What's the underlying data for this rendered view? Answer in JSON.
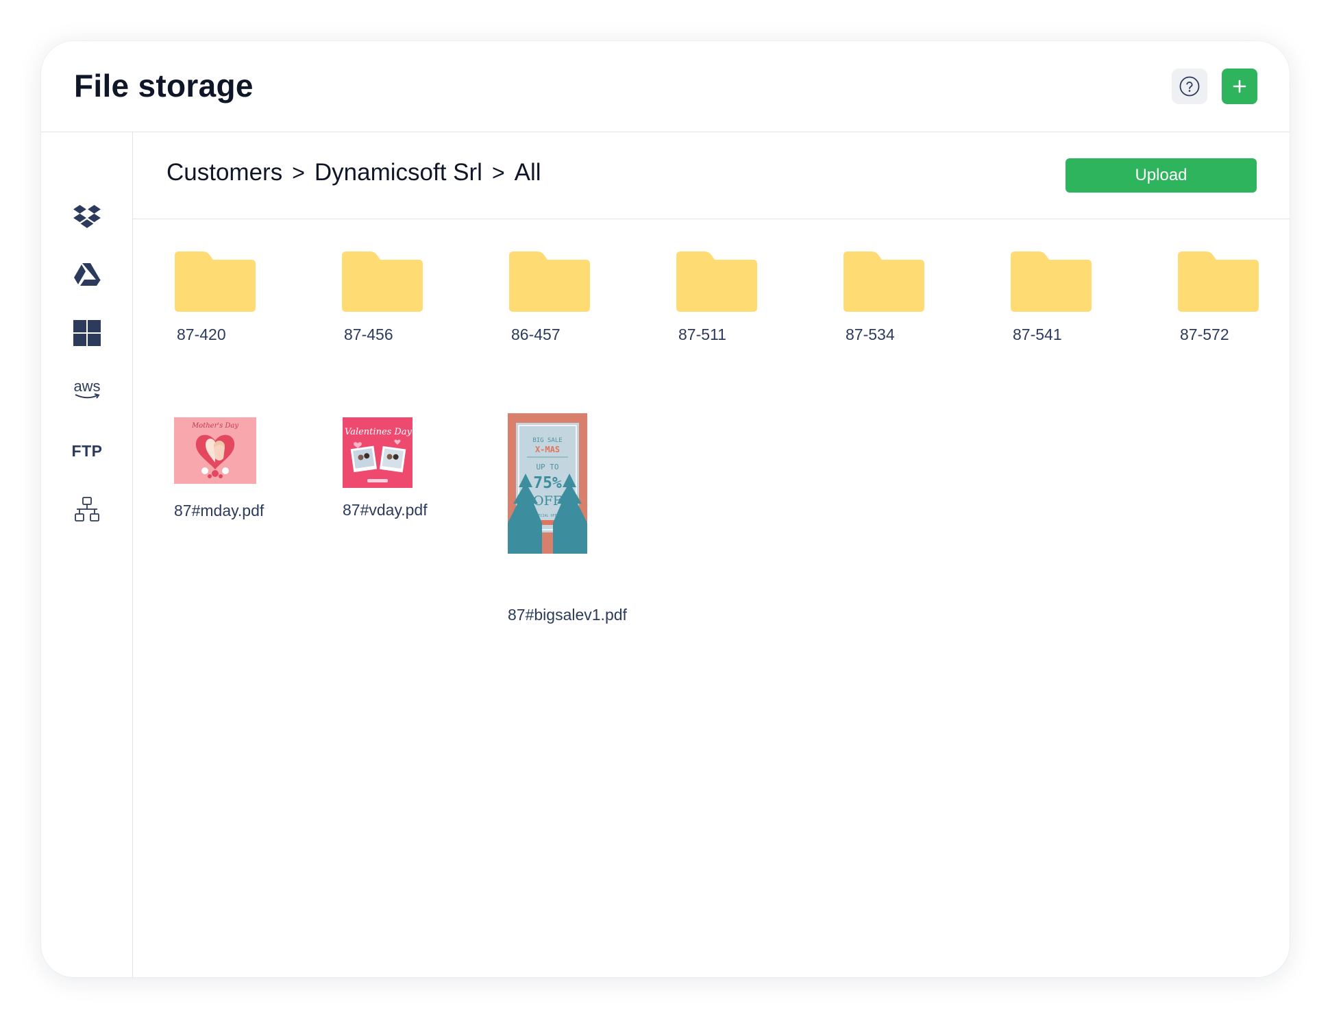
{
  "header": {
    "title": "File storage",
    "help_icon": "help-circle-icon",
    "add_icon": "plus-icon"
  },
  "sidebar": {
    "items": [
      {
        "name": "dropbox",
        "icon": "dropbox-icon"
      },
      {
        "name": "google-drive",
        "icon": "google-drive-icon"
      },
      {
        "name": "windows",
        "icon": "windows-icon"
      },
      {
        "name": "aws",
        "icon": "aws-icon",
        "text": "aws"
      },
      {
        "name": "ftp",
        "icon": "ftp-icon",
        "text": "FTP"
      },
      {
        "name": "network",
        "icon": "network-icon"
      }
    ]
  },
  "breadcrumb": {
    "items": [
      "Customers",
      "Dynamicsoft Srl",
      "All"
    ],
    "separator": ">"
  },
  "toolbar": {
    "upload_label": "Upload"
  },
  "folders": [
    {
      "name": "87-420"
    },
    {
      "name": "87-456"
    },
    {
      "name": "86-457"
    },
    {
      "name": "87-511"
    },
    {
      "name": "87-534"
    },
    {
      "name": "87-541"
    },
    {
      "name": "87-572"
    }
  ],
  "files": [
    {
      "name": "87#mday.pdf",
      "thumb_text": "Mother's Day"
    },
    {
      "name": "87#vday.pdf",
      "thumb_text": "Valentines Day"
    },
    {
      "name": "87#bigsalev1.pdf",
      "thumb_lines": [
        "BIG SALE",
        "X-MAS",
        "UP TO",
        "75%",
        "OFF",
        "SPECIAL OFFER"
      ]
    }
  ],
  "colors": {
    "accent": "#2fb45e",
    "folder": "#ffdb73",
    "text": "#0f1628",
    "icon": "#2c3a5c"
  }
}
